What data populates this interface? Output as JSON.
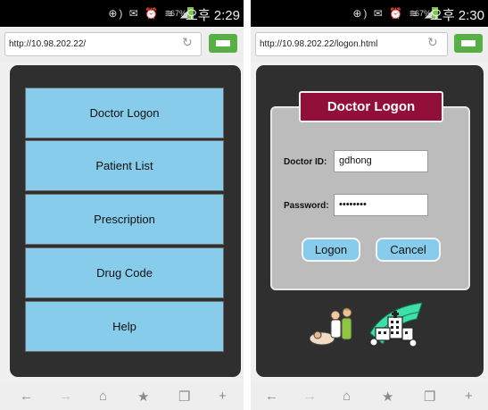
{
  "left_screen": {
    "status": {
      "battery": "67%",
      "time": "오후 2:29"
    },
    "url": "http://10.98.202.22/",
    "menu": [
      {
        "label": "Doctor Logon"
      },
      {
        "label": "Patient List"
      },
      {
        "label": "Prescription"
      },
      {
        "label": "Drug Code"
      },
      {
        "label": "Help"
      }
    ]
  },
  "right_screen": {
    "status": {
      "battery": "67%",
      "time": "오후 2:30"
    },
    "url": "http://10.98.202.22/logon.html",
    "form": {
      "title": "Doctor Logon",
      "doctor_id_label": "Doctor ID:",
      "doctor_id_value": "gdhong",
      "password_label": "Password:",
      "password_value": "••••••••",
      "logon_label": "Logon",
      "cancel_label": "Cancel"
    },
    "illustrations": [
      "doctor-patient-clipart",
      "hospital-clipart"
    ]
  },
  "toolbar_icons": [
    "back-icon",
    "forward-icon",
    "home-icon",
    "bookmark-star-icon",
    "tabs-icon",
    "add-icon"
  ],
  "colors": {
    "menu_button": "#87cceb",
    "title_banner": "#920f3a",
    "page_background": "#2f2f2f",
    "dialog_background": "#bcbcbc",
    "accent_green": "#58b045"
  }
}
